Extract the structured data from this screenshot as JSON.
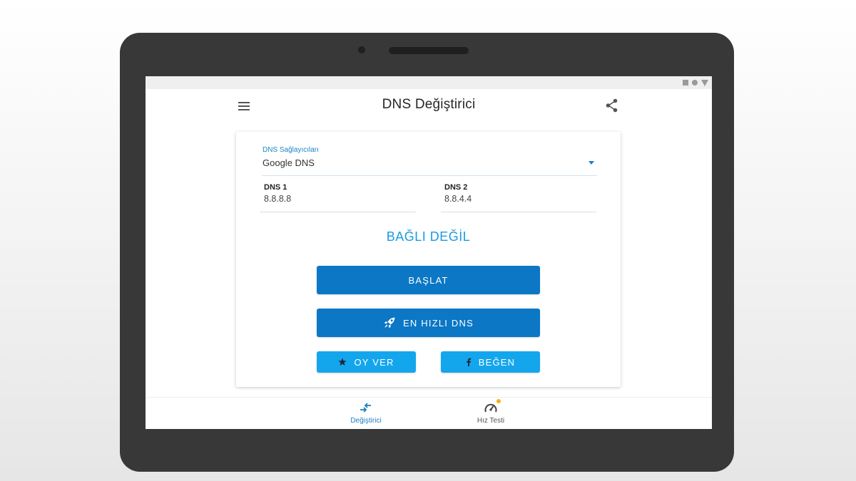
{
  "app": {
    "title": "DNS Değiştirici"
  },
  "icons": {
    "menu": "menu-icon",
    "share": "share-icon",
    "dropdown": "dropdown-arrow-icon",
    "rocket": "rocket-icon",
    "star": "star-icon",
    "facebook": "facebook-icon",
    "changer": "swap-arrows-icon",
    "speed": "speedometer-icon"
  },
  "provider": {
    "label": "DNS Sağlayıcıları",
    "value": "Google DNS"
  },
  "dns1": {
    "label": "DNS 1",
    "value": "8.8.8.8"
  },
  "dns2": {
    "label": "DNS 2",
    "value": "8.8.4.4"
  },
  "status": {
    "text": "BAĞLI DEĞİL"
  },
  "buttons": {
    "start": "BAŞLAT",
    "fastest": "EN HIZLI DNS",
    "vote": "OY VER",
    "like": "BEĞEN"
  },
  "bottom_nav": {
    "items": [
      {
        "label": "Değiştirici",
        "active": true
      },
      {
        "label": "Hız Testi",
        "active": false,
        "badge": true
      }
    ]
  },
  "colors": {
    "primary": "#0b77c5",
    "secondary": "#14a6ec",
    "status_text": "#1a9be0",
    "active_nav": "#1a7fc3",
    "badge": "#f2b21a",
    "device_frame": "#383838"
  }
}
